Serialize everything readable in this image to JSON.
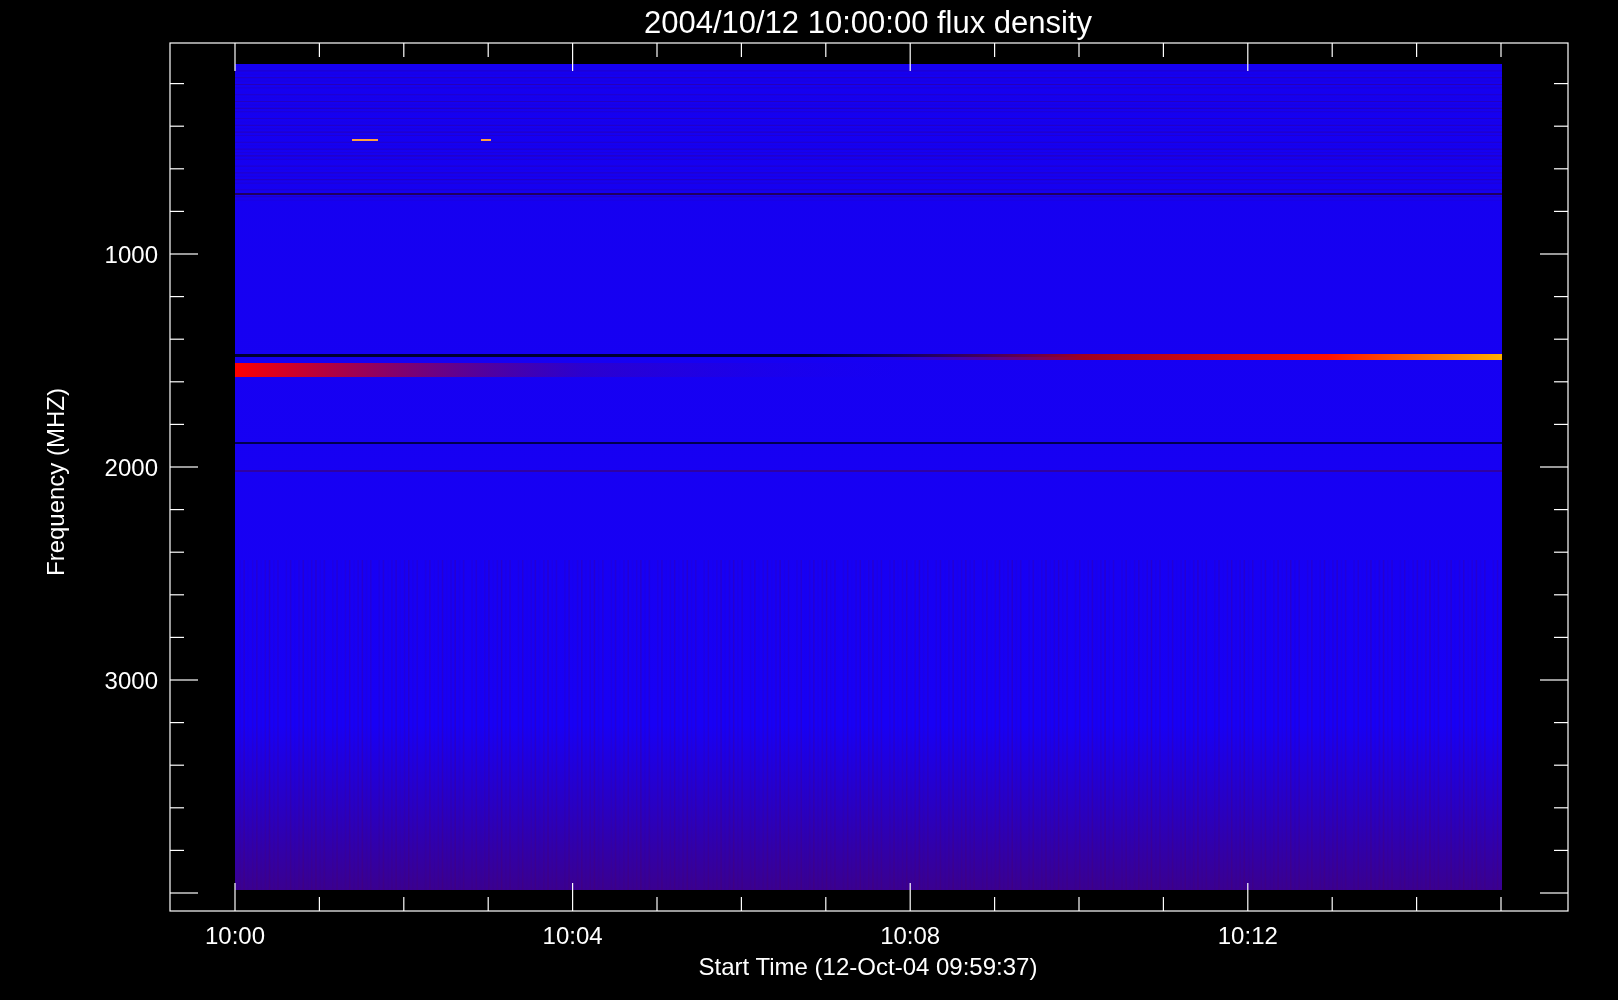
{
  "title": "2004/10/12 10:00:00 flux density",
  "y_axis": {
    "label": "Frequency (MHZ)",
    "ticks": [
      "1000",
      "2000",
      "3000"
    ]
  },
  "x_axis": {
    "label": "Start Time (12-Oct-04 09:59:37)",
    "ticks": [
      "10:00",
      "10:04",
      "10:08",
      "10:12"
    ]
  }
}
